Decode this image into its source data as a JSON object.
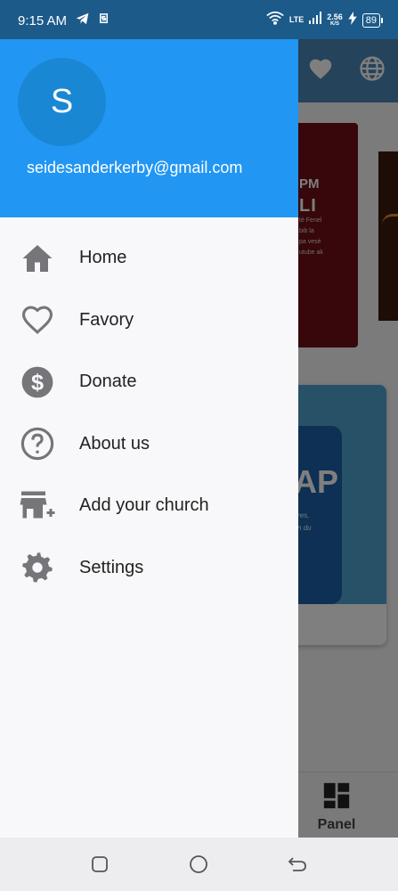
{
  "status_bar": {
    "time": "9:15 AM",
    "network_type": "LTE",
    "speed_value": "2.56",
    "speed_unit": "K/S",
    "battery": "89"
  },
  "background_app": {
    "card1": {
      "time_text": "PM",
      "big_text": "LI",
      "lines": [
        "tè Fenel",
        "bib la",
        "pa vesè",
        "utube ak"
      ]
    },
    "card3": {
      "big_text": "AP",
      "lines": [
        "res,",
        "n du"
      ]
    },
    "bottom_nav": {
      "panel_label": "Panel"
    }
  },
  "drawer": {
    "avatar_initial": "S",
    "email": "seidesanderkerby@gmail.com",
    "items": [
      {
        "label": "Home",
        "icon": "home-icon"
      },
      {
        "label": "Favory",
        "icon": "heart-outline-icon"
      },
      {
        "label": "Donate",
        "icon": "dollar-circle-icon"
      },
      {
        "label": "About us",
        "icon": "help-circle-icon"
      },
      {
        "label": "Add your church",
        "icon": "add-store-icon"
      },
      {
        "label": "Settings",
        "icon": "gear-icon"
      }
    ]
  },
  "colors": {
    "drawer_header": "#2196f3",
    "avatar_bg": "#1a87d5",
    "status_bar": "#1c5a8a",
    "icon_gray": "#75757a"
  }
}
